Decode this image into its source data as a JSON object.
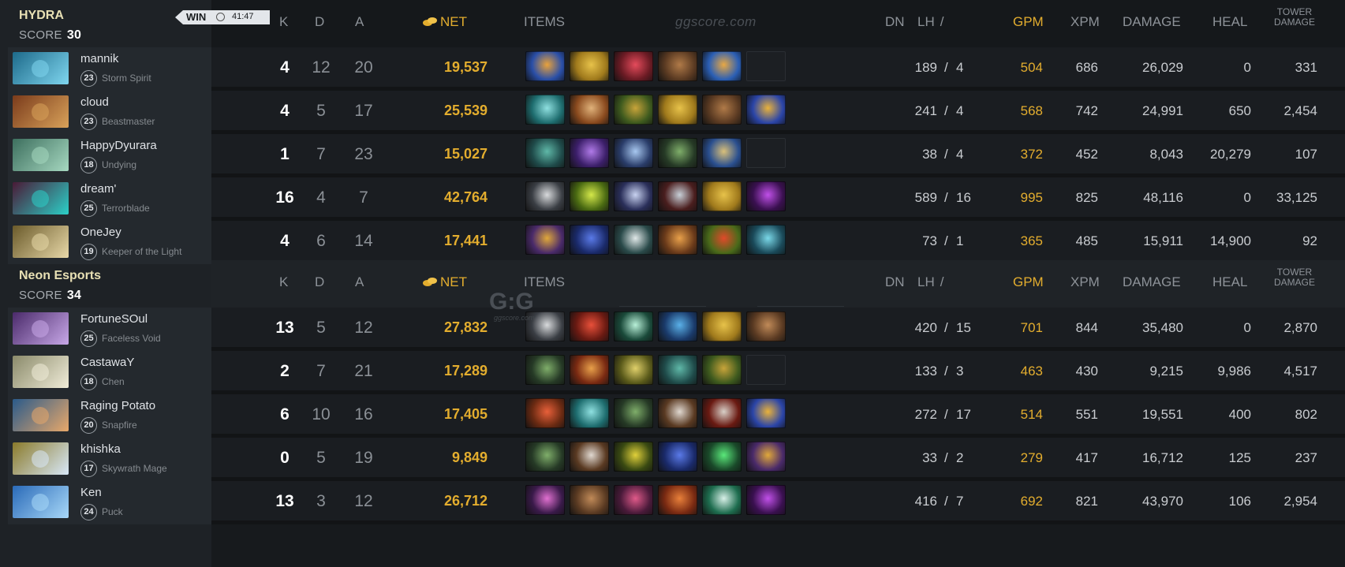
{
  "game_time": "41:47",
  "win_label": "WIN",
  "watermark": "ggscore.com",
  "logo_text": "G:G",
  "logo_sub": "ggscore.com",
  "score_label": "SCORE",
  "headers": {
    "k": "K",
    "d": "D",
    "a": "A",
    "net": "NET",
    "items": "ITEMS",
    "lh": "LH",
    "slash": "/",
    "dn": "DN",
    "gpm": "GPM",
    "xpm": "XPM",
    "damage": "DAMAGE",
    "heal": "HEAL",
    "tower_line1": "TOWER",
    "tower_line2": "DAMAGE"
  },
  "colors": {
    "gold": "#e3ad2e",
    "win_badge": "#e3e6ea",
    "team_name": "#e8e0b4"
  },
  "teams": [
    {
      "name": "HYDRA",
      "score": "30",
      "players": [
        {
          "name": "mannik",
          "level": "23",
          "hero": "Storm Spirit",
          "k": "4",
          "d": "12",
          "a": "20",
          "net": "19,537",
          "lh": "189",
          "dn": "4",
          "gpm": "504",
          "xpm": "686",
          "damage": "26,029",
          "heal": "0",
          "tower": "331",
          "avatar_colors": [
            "#1d6a8a",
            "#7fd6ef"
          ],
          "items": [
            "#2a4fa8|#e9a23b",
            "#a07a1c|#e7c24a",
            "#6b1b24|#e44b5b",
            "#5a3a22|#b07a48",
            "#2b5fb5|#e8a844",
            null
          ]
        },
        {
          "name": "cloud",
          "level": "23",
          "hero": "Beastmaster",
          "k": "4",
          "d": "5",
          "a": "17",
          "net": "25,539",
          "lh": "241",
          "dn": "4",
          "gpm": "568",
          "xpm": "742",
          "damage": "24,991",
          "heal": "650",
          "tower": "2,454",
          "avatar_colors": [
            "#7a3b1b",
            "#d9a25a"
          ],
          "items": [
            "#1e6d6f|#8fe0e0",
            "#8a4a1e|#e0b27a",
            "#3e5a1e|#c8a43a",
            "#a07a1c|#e7c24a",
            "#5a3a22|#b07a48",
            "#2b45a8|#e9b23b"
          ]
        },
        {
          "name": "HappyDyurara",
          "level": "18",
          "hero": "Undying",
          "k": "1",
          "d": "7",
          "a": "23",
          "net": "15,027",
          "lh": "38",
          "dn": "4",
          "gpm": "372",
          "xpm": "452",
          "damage": "8,043",
          "heal": "20,279",
          "tower": "107",
          "avatar_colors": [
            "#3d6f5e",
            "#a6d8c0"
          ],
          "items": [
            "#1f4b4a|#5fb8a8",
            "#3c1f6a|#b07ae8",
            "#2a3d6a|#a8c8f0",
            "#263a26|#7fae6a",
            "#2a4f8f|#d9c07a",
            null
          ]
        },
        {
          "name": "dream'",
          "level": "25",
          "hero": "Terrorblade",
          "k": "16",
          "d": "4",
          "a": "7",
          "net": "42,764",
          "lh": "589",
          "dn": "16",
          "gpm": "995",
          "xpm": "825",
          "damage": "48,116",
          "heal": "0",
          "tower": "33,125",
          "avatar_colors": [
            "#4a1a36",
            "#2cd0c8"
          ],
          "items": [
            "#3a3e44|#d8dadc",
            "#4a6a12|#d4e84a",
            "#2a2f5a|#c8d2f0",
            "#4a1e1e|#c8d0d8",
            "#a07a1c|#e7c24a",
            "#3a1050|#c050e8"
          ]
        },
        {
          "name": "OneJey",
          "level": "19",
          "hero": "Keeper of the Light",
          "k": "4",
          "d": "6",
          "a": "14",
          "net": "17,441",
          "lh": "73",
          "dn": "1",
          "gpm": "365",
          "xpm": "485",
          "damage": "15,911",
          "heal": "14,900",
          "tower": "92",
          "avatar_colors": [
            "#6a5a2a",
            "#e8d8a8"
          ],
          "items": [
            "#4a2a6a|#e0a83a",
            "#1a2a6a|#5a7ae8",
            "#2a4a4a|#e0e8e8",
            "#6a3a1a|#e8a04a",
            "#4a6a1a|#e04a2a",
            "#1a4a5a|#7ad8e8",
            "#5a3a22|#b07a48"
          ]
        }
      ]
    },
    {
      "name": "Neon Esports",
      "score": "34",
      "players": [
        {
          "name": "FortuneSOul",
          "level": "25",
          "hero": "Faceless Void",
          "k": "13",
          "d": "5",
          "a": "12",
          "net": "27,832",
          "lh": "420",
          "dn": "15",
          "gpm": "701",
          "xpm": "844",
          "damage": "35,480",
          "heal": "0",
          "tower": "2,870",
          "avatar_colors": [
            "#4a2a6a",
            "#c8a8e8"
          ],
          "items": [
            "#3a3e44|#d8dadc",
            "#6a1a12|#e8503a",
            "#1a4a3a|#b8f0d8",
            "#1a3a6a|#5ab0e8",
            "#a07a1c|#e7c24a",
            "#5a3a22|#c08a58"
          ]
        },
        {
          "name": "CastawaY",
          "level": "18",
          "hero": "Chen",
          "k": "2",
          "d": "7",
          "a": "21",
          "net": "17,289",
          "lh": "133",
          "dn": "3",
          "gpm": "463",
          "xpm": "430",
          "damage": "9,215",
          "heal": "9,986",
          "tower": "4,517",
          "avatar_colors": [
            "#8a8a6a",
            "#f0ecd8"
          ],
          "items": [
            "#263a26|#7fae6a",
            "#7a2a12|#e8a04a",
            "#5a5a1a|#e0d06a",
            "#1f4b4a|#5fb8a8",
            "#3e5a1e|#c8a43a",
            null
          ]
        },
        {
          "name": "Raging Potato",
          "level": "20",
          "hero": "Snapfire",
          "k": "6",
          "d": "10",
          "a": "16",
          "net": "17,405",
          "lh": "272",
          "dn": "17",
          "gpm": "514",
          "xpm": "551",
          "damage": "19,551",
          "heal": "400",
          "tower": "802",
          "avatar_colors": [
            "#2a5a8a",
            "#e8a86a"
          ],
          "items": [
            "#6a2a12|#e8603a",
            "#1e6d6f|#8fe0e0",
            "#263a26|#7fae6a",
            "#5a3a22|#e0d8d0",
            "#6a1a12|#d8d0c8",
            "#2b45a8|#e9b23b"
          ]
        },
        {
          "name": "khishka",
          "level": "17",
          "hero": "Skywrath Mage",
          "k": "0",
          "d": "5",
          "a": "19",
          "net": "9,849",
          "lh": "33",
          "dn": "2",
          "gpm": "279",
          "xpm": "417",
          "damage": "16,712",
          "heal": "125",
          "tower": "237",
          "avatar_colors": [
            "#8a7a2a",
            "#d8e8f8"
          ],
          "items": [
            "#263a26|#7fae6a",
            "#5a3a22|#e0d8d0",
            "#3a4a12|#e0d03a",
            "#1a2a6a|#5a7ae8",
            "#1a4a2a|#5ae87a",
            "#4a2a6a|#e0a83a"
          ]
        },
        {
          "name": "Ken",
          "level": "24",
          "hero": "Puck",
          "k": "13",
          "d": "3",
          "a": "12",
          "net": "26,712",
          "lh": "416",
          "dn": "7",
          "gpm": "692",
          "xpm": "821",
          "damage": "43,970",
          "heal": "106",
          "tower": "2,954",
          "avatar_colors": [
            "#2a6ab8",
            "#a8d8f8"
          ],
          "items": [
            "#3a1a4a|#e070d0",
            "#5a3a22|#c08a58",
            "#4a1a3a|#e05a8a",
            "#7a2a12|#e8803a",
            "#1e6d4f|#d8f0e8",
            "#3a1050|#c050e8"
          ]
        }
      ]
    }
  ]
}
